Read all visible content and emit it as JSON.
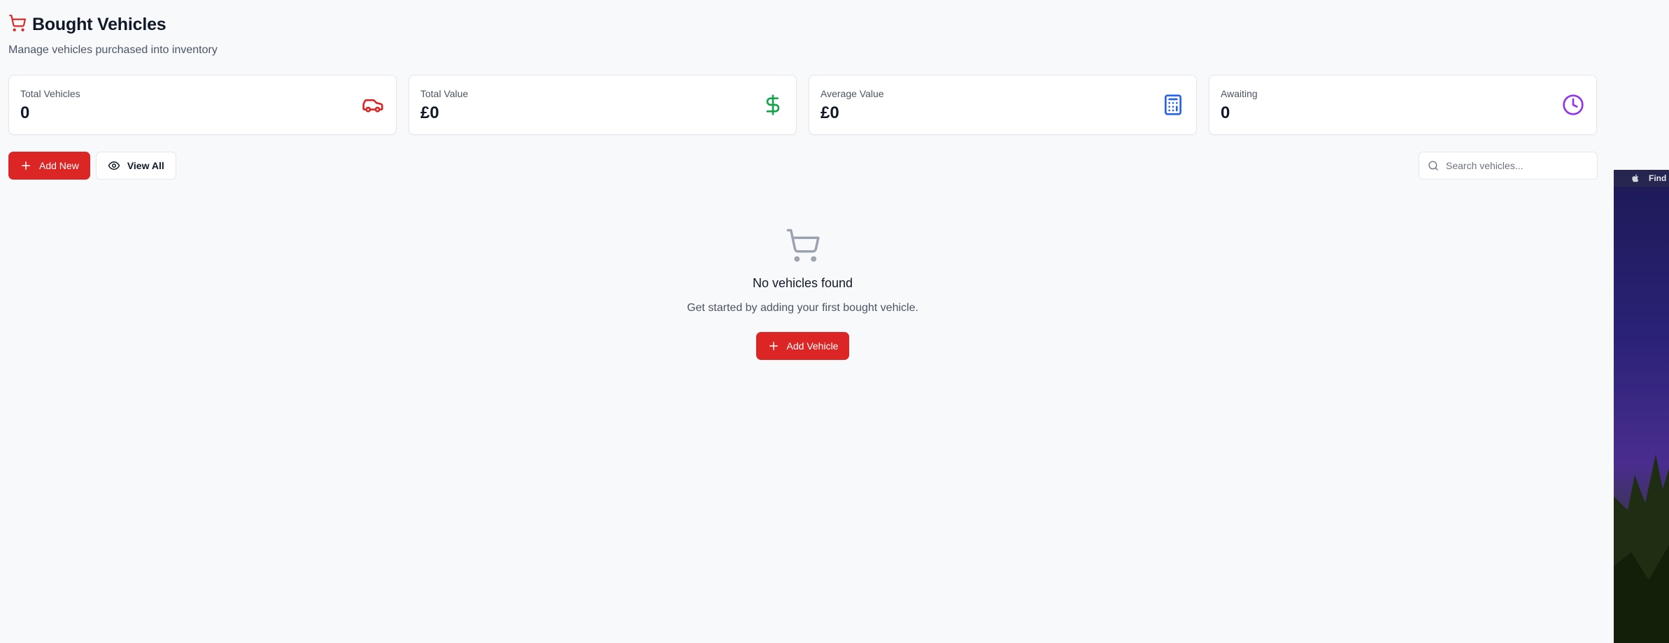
{
  "header": {
    "title": "Bought Vehicles",
    "subtitle": "Manage vehicles purchased into inventory",
    "icon": "shopping-cart-icon",
    "accent_color": "#dc2626"
  },
  "stats": [
    {
      "label": "Total Vehicles",
      "value": "0",
      "icon": "car-icon",
      "color": "#dc2626"
    },
    {
      "label": "Total Value",
      "value": "£0",
      "icon": "dollar-sign-icon",
      "color": "#16a34a"
    },
    {
      "label": "Average Value",
      "value": "£0",
      "icon": "calculator-icon",
      "color": "#2563eb"
    },
    {
      "label": "Awaiting",
      "value": "0",
      "icon": "clock-icon",
      "color": "#9333ea"
    }
  ],
  "toolbar": {
    "add_new_label": "Add New",
    "view_all_label": "View All"
  },
  "search": {
    "placeholder": "Search vehicles...",
    "value": ""
  },
  "empty_state": {
    "title": "No vehicles found",
    "text": "Get started by adding your first bought vehicle.",
    "button_label": "Add Vehicle"
  },
  "desktop": {
    "menubar_app": "Find"
  }
}
